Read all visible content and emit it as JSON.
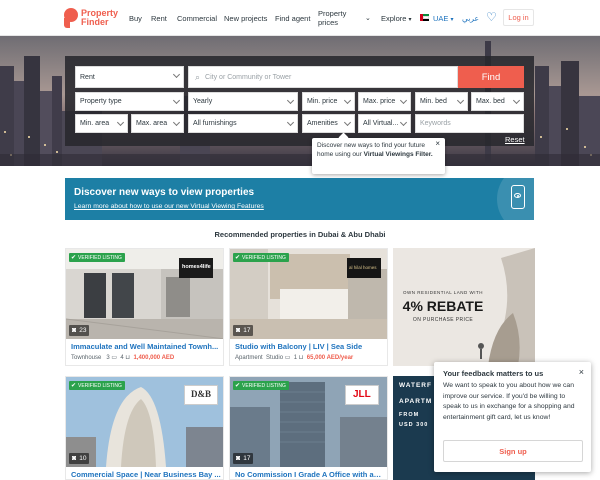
{
  "header": {
    "logo_line1": "Property",
    "logo_line2": "Finder",
    "nav": {
      "buy": "Buy",
      "rent": "Rent",
      "commercial": "Commercial",
      "new_projects": "New projects",
      "find_agent": "Find agent",
      "property_prices_line1": "Property",
      "property_prices_line2": "prices",
      "explore": "Explore"
    },
    "region": "UAE",
    "language": "عربي",
    "login": "Log in"
  },
  "search": {
    "purpose": "Rent",
    "location_placeholder": "City or Community or Tower",
    "find": "Find",
    "property_type": "Property type",
    "frequency": "Yearly",
    "min_price": "Min. price",
    "max_price": "Max. price",
    "min_bed": "Min. bed",
    "max_bed": "Max. bed",
    "min_area": "Min. area",
    "max_area": "Max. area",
    "furnishing": "All furnishings",
    "amenities": "Amenities",
    "virtual": "All Virtual...",
    "keywords_placeholder": "Keywords",
    "reset": "Reset"
  },
  "tooltip": {
    "text_a": "Discover new ways to find your future home using our ",
    "text_b": "Virtual Viewings Filter.",
    "close": "×"
  },
  "banner": {
    "title": "Discover new ways to view properties",
    "link": "Learn more about how to use our new Virtual Viewing Features"
  },
  "section_title": "Recommended properties in Dubai & Abu Dhabi",
  "cards": [
    {
      "verified": "VERIFIED LISTING",
      "photos": "23",
      "title": "Immaculate and Well Maintained Townh...",
      "type": "Townhouse",
      "beds": "3",
      "baths": "4",
      "price": "1,400,000 AED",
      "brand": "homes4life"
    },
    {
      "verified": "VERIFIED LISTING",
      "photos": "17",
      "title": "Studio with Balcony | LIV | Sea Side",
      "type": "Apartment",
      "beds": "Studio",
      "baths": "1",
      "price": "65,000 AED/year",
      "brand": "al hilal homes"
    },
    {
      "verified": "VERIFIED LISTING",
      "photos": "10",
      "title": "Commercial Space | Near Business Bay ...",
      "brand": "D&B"
    },
    {
      "verified": "VERIFIED LISTING",
      "photos": "17",
      "title": "No Commission I Grade A Office with am...",
      "brand": "JLL"
    }
  ],
  "ad": {
    "line1": "OWN RESIDENTIAL LAND WITH",
    "line2": "4% REBATE",
    "line3": "ON PURCHASE PRICE"
  },
  "ad2": {
    "line1": "WATERF",
    "line2": "APARTM",
    "line3": "FROM",
    "line4": "USD 300"
  },
  "feedback": {
    "title": "Your feedback matters to us",
    "body": "We want to speak to you about how we can improve our service. If you'd be willing to speak to us in exchange for a shopping and entertainment gift card, let us know!",
    "button": "Sign up",
    "close": "×"
  },
  "colors": {
    "brand_red": "#ef5e4e",
    "link_blue": "#1e73be",
    "banner_blue": "#1d7fa5",
    "verified_green": "#2ba24c"
  }
}
